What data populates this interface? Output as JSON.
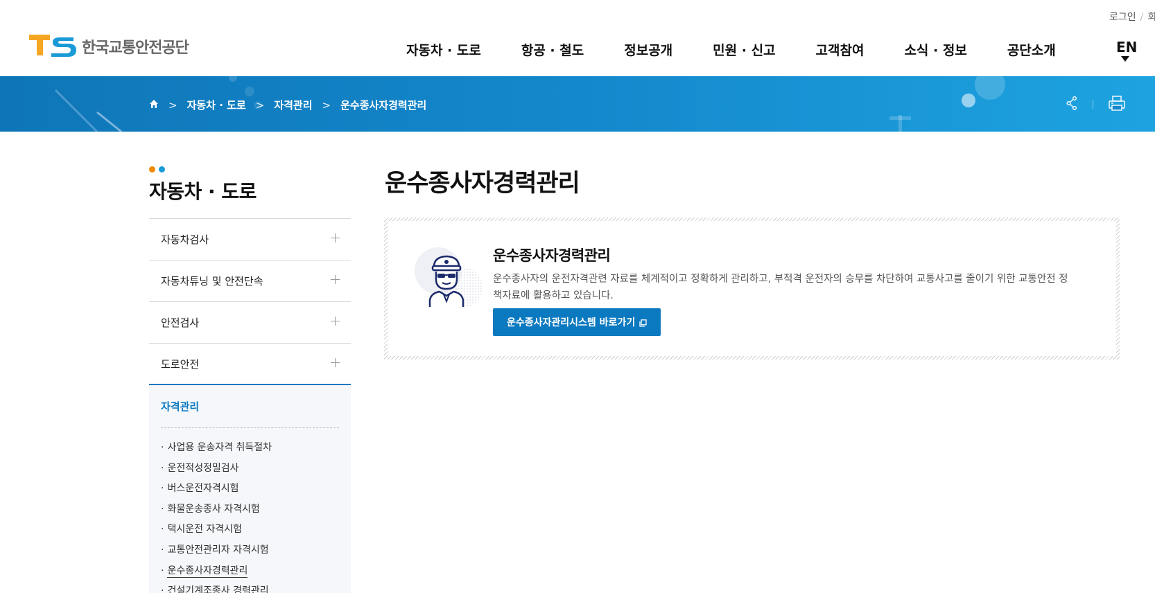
{
  "header": {
    "util_links": [
      "로그인",
      "회"
    ],
    "logo": {
      "mark": "TS",
      "name": "한국교통안전공단"
    },
    "nav": [
      "자동차 · 도로",
      "항공 · 철도",
      "정보공개",
      "민원 · 신고",
      "고객참여",
      "소식 · 정보",
      "공단소개"
    ],
    "lang": "EN"
  },
  "breadcrumb": {
    "home_icon": "home-icon",
    "items": [
      "자동차 · 도로",
      "자격관리",
      "운수종사자경력관리"
    ],
    "tools": [
      "share-icon",
      "print-icon"
    ]
  },
  "sidebar": {
    "title": "자동차 · 도로",
    "items": [
      {
        "label": "자동차검사"
      },
      {
        "label": "자동차튜닝 및 안전단속"
      },
      {
        "label": "안전검사"
      },
      {
        "label": "도로안전"
      }
    ],
    "active": {
      "label": "자격관리",
      "sub_items": [
        "사업용 운송자격 취득절차",
        "운전적성정밀검사",
        "버스운전자격시험",
        "화물운송종사 자격시험",
        "택시운전 자격시험",
        "교통안전관리자 자격시험",
        "운수종사자경력관리",
        "건설기계조종사 경력관리"
      ],
      "current_index": 6
    }
  },
  "main": {
    "page_title": "운수종사자경력관리",
    "info": {
      "icon": "driver-icon",
      "title": "운수종사자경력관리",
      "description": "운수종사자의 운전자격관련 자료를 체계적이고 정확하게 관리하고, 부적격 운전자의 승무를 차단하여 교통사고를 줄이기 위한 교통안전 정책자료에 활용하고 있습니다.",
      "button": "운수종사자관리시스템 바로가기"
    }
  },
  "colors": {
    "brand_blue": "#0b79c0",
    "logo_orange": "#f5a623",
    "logo_blue": "#1a9ad6",
    "dot_orange": "#f08a00",
    "dot_blue": "#1a9ad6",
    "driver_icon": "#1b2a6b"
  }
}
